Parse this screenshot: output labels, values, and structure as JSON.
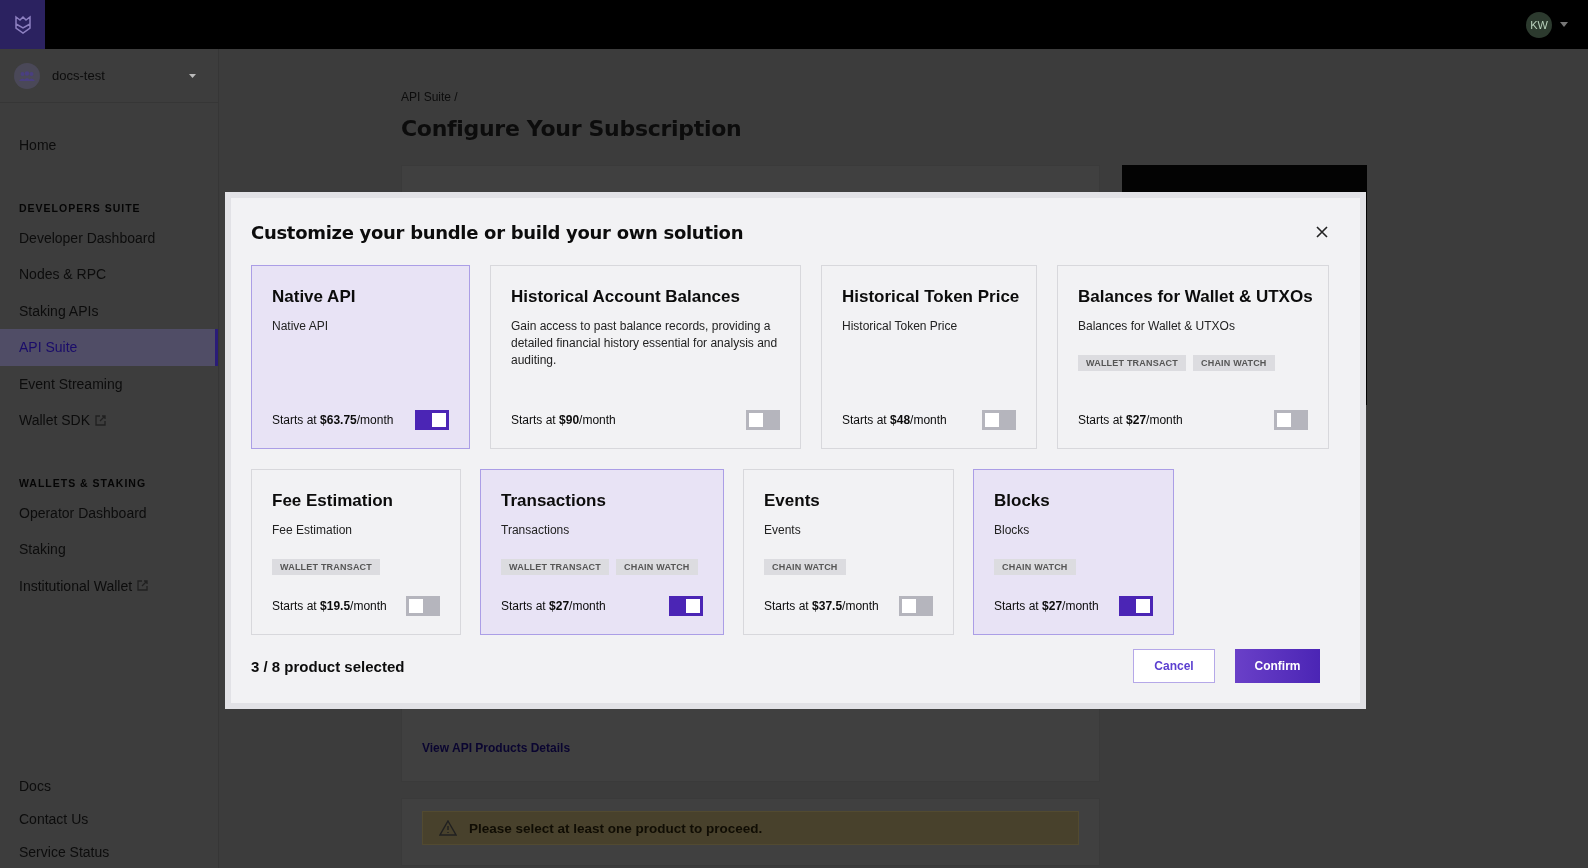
{
  "top_bar": {
    "avatar": {
      "initials": "KW"
    }
  },
  "sidebar": {
    "workspace": "docs-test",
    "sections": [
      {
        "items": [
          {
            "label": "Home",
            "external": false,
            "selected": false
          }
        ]
      },
      {
        "heading": "DEVELOPERS SUITE",
        "items": [
          {
            "label": "Developer Dashboard",
            "external": false,
            "selected": false
          },
          {
            "label": "Nodes & RPC",
            "external": false,
            "selected": false
          },
          {
            "label": "Staking APIs",
            "external": false,
            "selected": false
          },
          {
            "label": "API Suite",
            "external": false,
            "selected": true
          },
          {
            "label": "Event Streaming",
            "external": false,
            "selected": false
          },
          {
            "label": "Wallet SDK",
            "external": true,
            "selected": false
          }
        ]
      },
      {
        "heading": "WALLETS & STAKING",
        "items": [
          {
            "label": "Operator Dashboard",
            "external": false,
            "selected": false
          },
          {
            "label": "Staking",
            "external": false,
            "selected": false
          },
          {
            "label": "Institutional Wallet",
            "external": true,
            "selected": false
          }
        ]
      }
    ],
    "footer_items": [
      {
        "label": "Docs",
        "selected": false
      },
      {
        "label": "Contact Us",
        "selected": false
      },
      {
        "label": "Service Status",
        "selected": false
      }
    ]
  },
  "main": {
    "breadcrumb": "API Suite /",
    "title": "Configure Your Subscription",
    "details_link": "View API Products Details",
    "warning": "Please select at least one product to proceed."
  },
  "modal": {
    "title": "Customize your bundle or build your own solution",
    "product_rows": [
      [
        {
          "name": "Native API",
          "description": "Native API",
          "price": "Starts at **$63.75**/month",
          "selected": true
        },
        {
          "name": "Historical Account Balances",
          "description": "Gain access to past balance records, providing a detailed financial history essential for analysis and auditing.",
          "price": "Starts at **$90**/month",
          "selected": false
        },
        {
          "name": "Historical Token Price",
          "description": "Historical Token Price",
          "price": "Starts at **$48**/month",
          "selected": false
        },
        {
          "name": "Balances for Wallet & UTXOs",
          "description": "Balances for Wallet & UTXOs",
          "tags": [
            "WALLET TRANSACT",
            "CHAIN WATCH"
          ],
          "price": "Starts at **$27**/month",
          "selected": false
        }
      ],
      [
        {
          "name": "Fee Estimation",
          "description": "Fee Estimation",
          "tags": [
            "WALLET TRANSACT"
          ],
          "price": "Starts at **$19.5**/month",
          "selected": false
        },
        {
          "name": "Transactions",
          "description": "Transactions",
          "tags": [
            "WALLET TRANSACT",
            "CHAIN WATCH"
          ],
          "price": "Starts at **$27**/month",
          "selected": true
        },
        {
          "name": "Events",
          "description": "Events",
          "tags": [
            "CHAIN WATCH"
          ],
          "price": "Starts at **$37.5**/month",
          "selected": false
        },
        {
          "name": "Blocks",
          "description": "Blocks",
          "tags": [
            "CHAIN WATCH"
          ],
          "price": "Starts at **$27**/month",
          "selected": true
        }
      ]
    ],
    "selection_count": "3 / 8 product selected",
    "cancel_button": "Cancel",
    "confirm_button": "Confirm"
  }
}
